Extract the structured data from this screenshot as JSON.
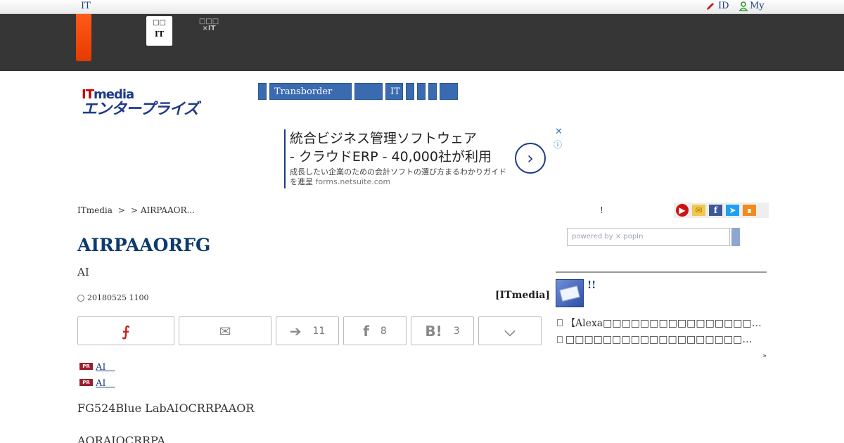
{
  "topbar": {
    "brand": "IT",
    "id_link": "ID",
    "my_link": "My"
  },
  "header": {
    "site_tab_active": {
      "line1": "□□",
      "line2": "IT"
    },
    "site_tab": {
      "line1": "□□□",
      "line2": "×IT"
    }
  },
  "logo": {
    "it": "IT",
    "media": "media",
    "kana": "エンタープライズ"
  },
  "section_nav": [
    "",
    "Transborder",
    "",
    "IT",
    "",
    "",
    "",
    ""
  ],
  "ad": {
    "headline_1": "統合ビジネス管理ソフトウェア",
    "headline_2": "- クラウドERP - 40,000社が利用",
    "sub": "成長したい企業のための会計ソフトの選び方まるわかりガイドを進呈",
    "domain": "forms.netsuite.com",
    "arrow": "›",
    "close": "✕",
    "info": "ⓘ"
  },
  "breadcrumb": {
    "home": "ITmedia",
    "sep1": ">",
    "sep2": ">",
    "current": "AIRPAAOR..."
  },
  "mid_mark": "!",
  "search": {
    "placeholder": "powered by ⨯ popIn"
  },
  "article": {
    "title": "AIRPAAORFG",
    "subtitle": "AI",
    "date": "20180525 1100",
    "byline": "[ITmedia]",
    "pr_links": [
      "AI　",
      "AI　"
    ],
    "pr_tag": "PR",
    "body_1": "FG524Blue LabAIOCRRPAAOR",
    "body_2": "AORAIOCRRPA"
  },
  "share": {
    "pdf_glyph": "⨍",
    "mail_glyph": "✉",
    "twitter_glyph": "➔",
    "twitter_count": "11",
    "facebook_glyph": "f",
    "facebook_count": "8",
    "hatena_glyph": "B!",
    "hatena_count": "3",
    "pocket_glyph": "⌵"
  },
  "sidebar": {
    "title": "!!",
    "items": [
      "【Alexa□□□□□□□□□□□□□□□□…",
      "□□□□□□□□□□□□□□□□□□□…"
    ],
    "more": "»"
  }
}
